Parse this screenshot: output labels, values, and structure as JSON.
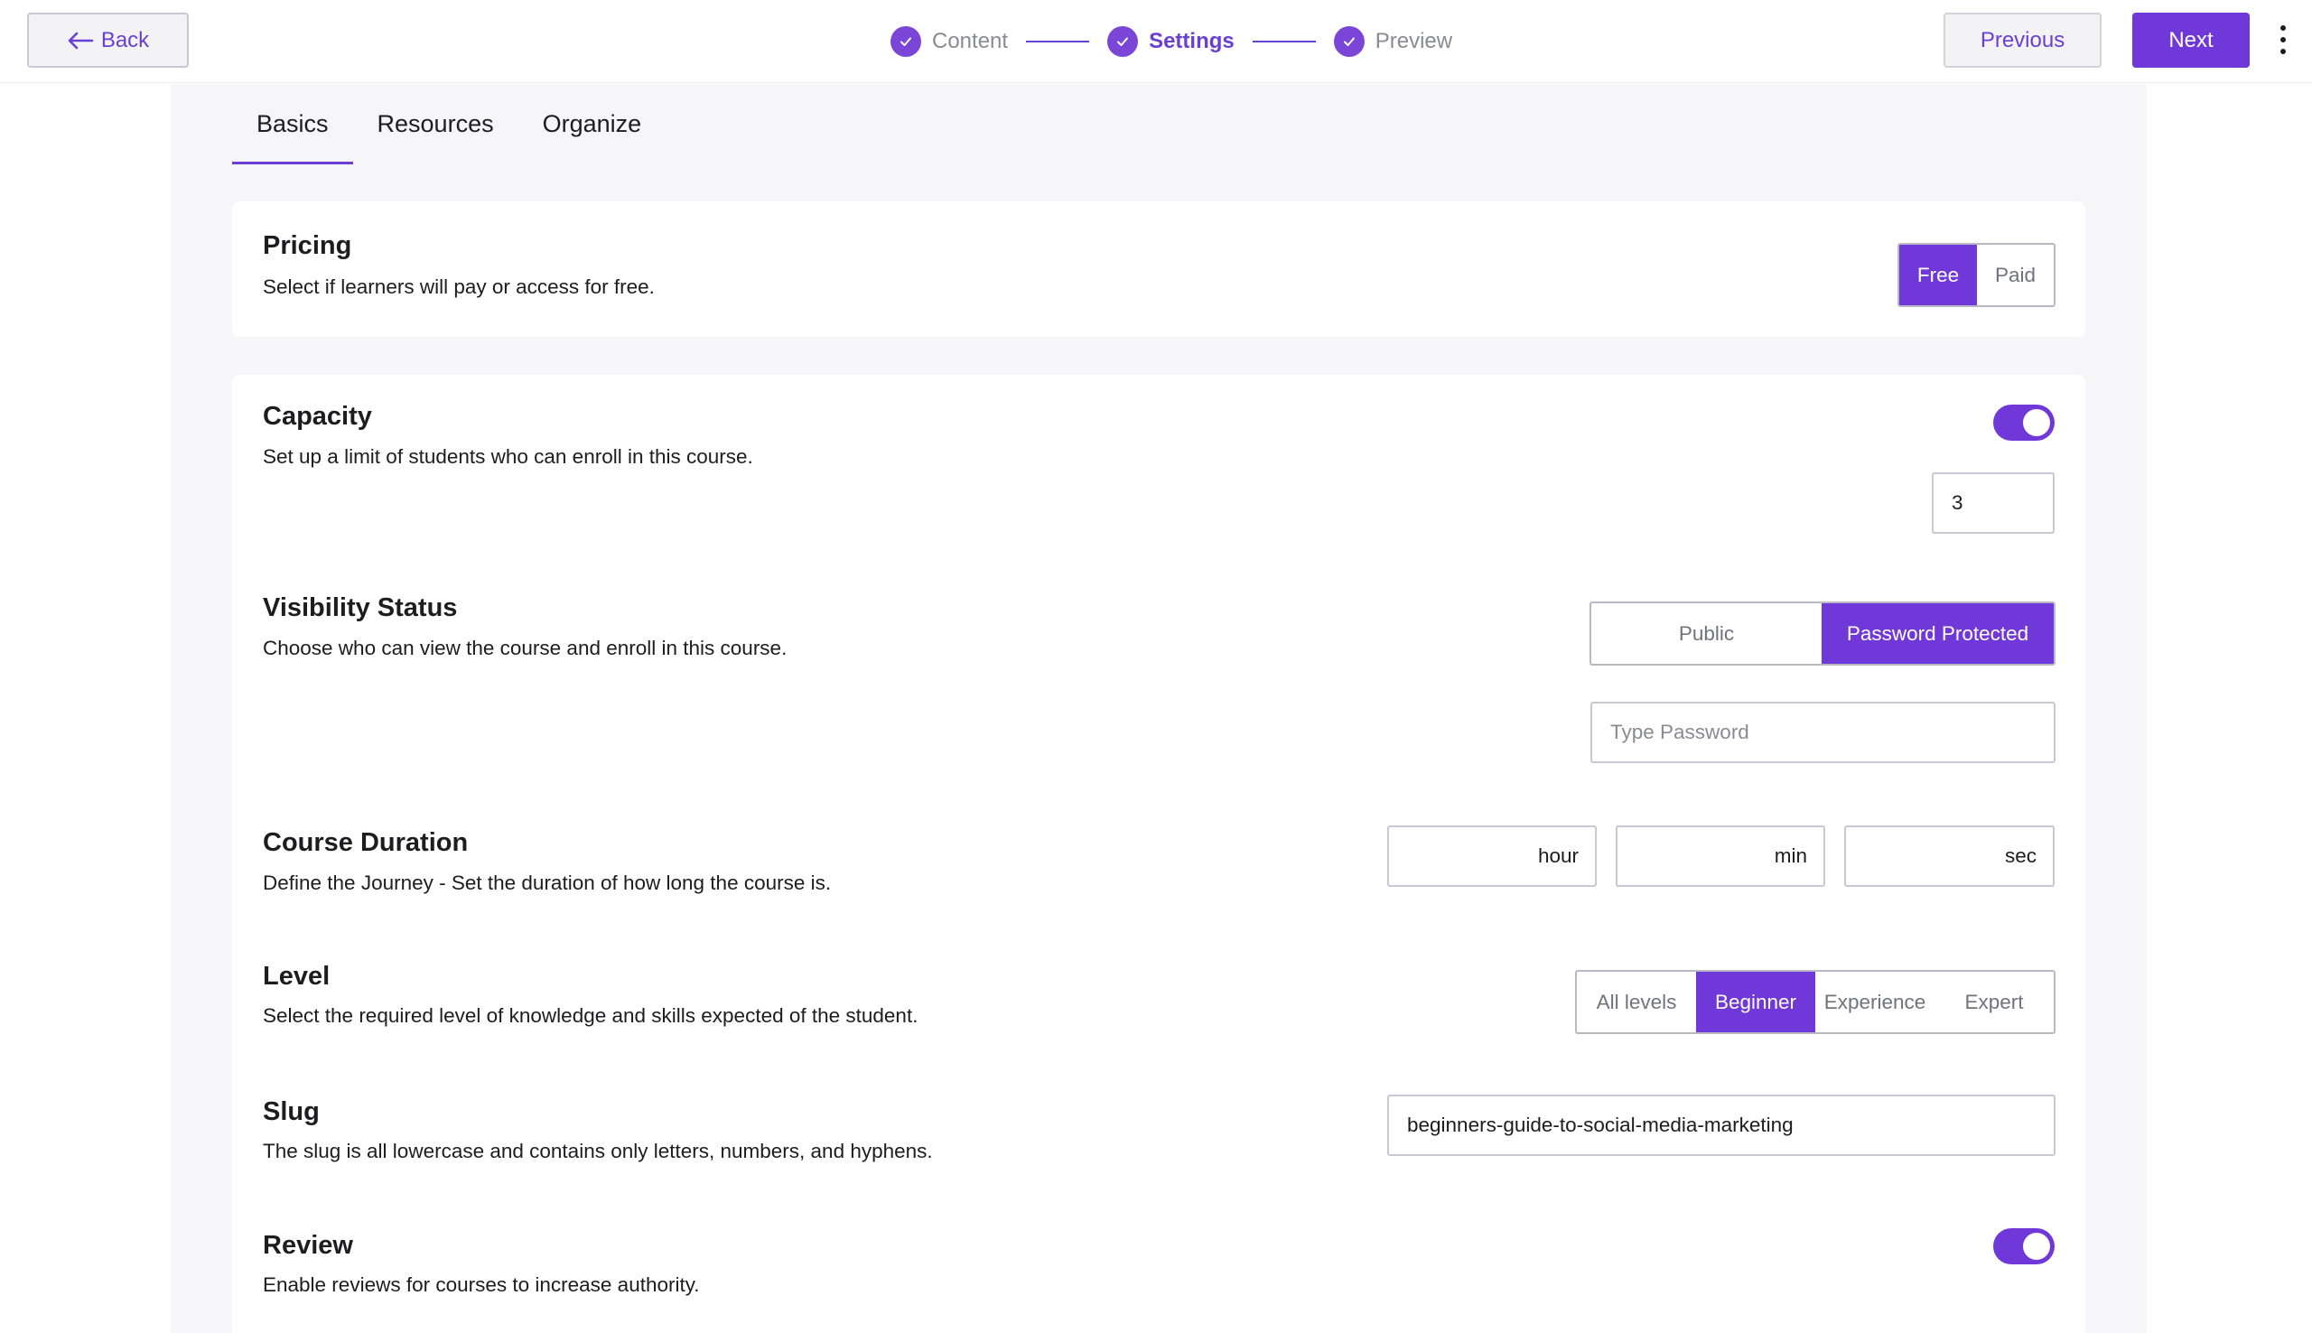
{
  "topbar": {
    "back_label": "Back",
    "steps": [
      {
        "label": "Content",
        "state": "done"
      },
      {
        "label": "Settings",
        "state": "active"
      },
      {
        "label": "Preview",
        "state": "done"
      }
    ],
    "previous_label": "Previous",
    "next_label": "Next"
  },
  "tabs": [
    "Basics",
    "Resources",
    "Organize"
  ],
  "active_tab": "Basics",
  "pricing": {
    "title": "Pricing",
    "description": "Select if learners will pay or access for free.",
    "options": [
      "Free",
      "Paid"
    ],
    "selected": "Free"
  },
  "capacity": {
    "title": "Capacity",
    "description": "Set up a limit of students who can enroll in this course.",
    "enabled": true,
    "value": "3"
  },
  "visibility": {
    "title": "Visibility Status",
    "description": "Choose who can view the course and enroll in this course.",
    "options": [
      "Public",
      "Password Protected"
    ],
    "selected": "Password Protected",
    "password_placeholder": "Type Password"
  },
  "duration": {
    "title": "Course Duration",
    "description": "Define the Journey - Set the duration of how long the course is.",
    "units": [
      "hour",
      "min",
      "sec"
    ]
  },
  "level": {
    "title": "Level",
    "description": "Select the required level of knowledge and skills expected of the student.",
    "options": [
      "All levels",
      "Beginner",
      "Experience",
      "Expert"
    ],
    "selected": "Beginner"
  },
  "slug": {
    "title": "Slug",
    "description": "The slug is all lowercase and contains only letters, numbers, and hyphens.",
    "value": "beginners-guide-to-social-media-marketing"
  },
  "review": {
    "title": "Review",
    "description": "Enable reviews for courses to increase authority.",
    "enabled": true
  },
  "colors": {
    "accent": "#7138d9",
    "accent_text": "#6b3fd4",
    "background": "#f6f6f8"
  },
  "icons": {
    "back": "arrow-left-icon",
    "step_done": "check-icon",
    "menu": "kebab-menu-icon"
  }
}
